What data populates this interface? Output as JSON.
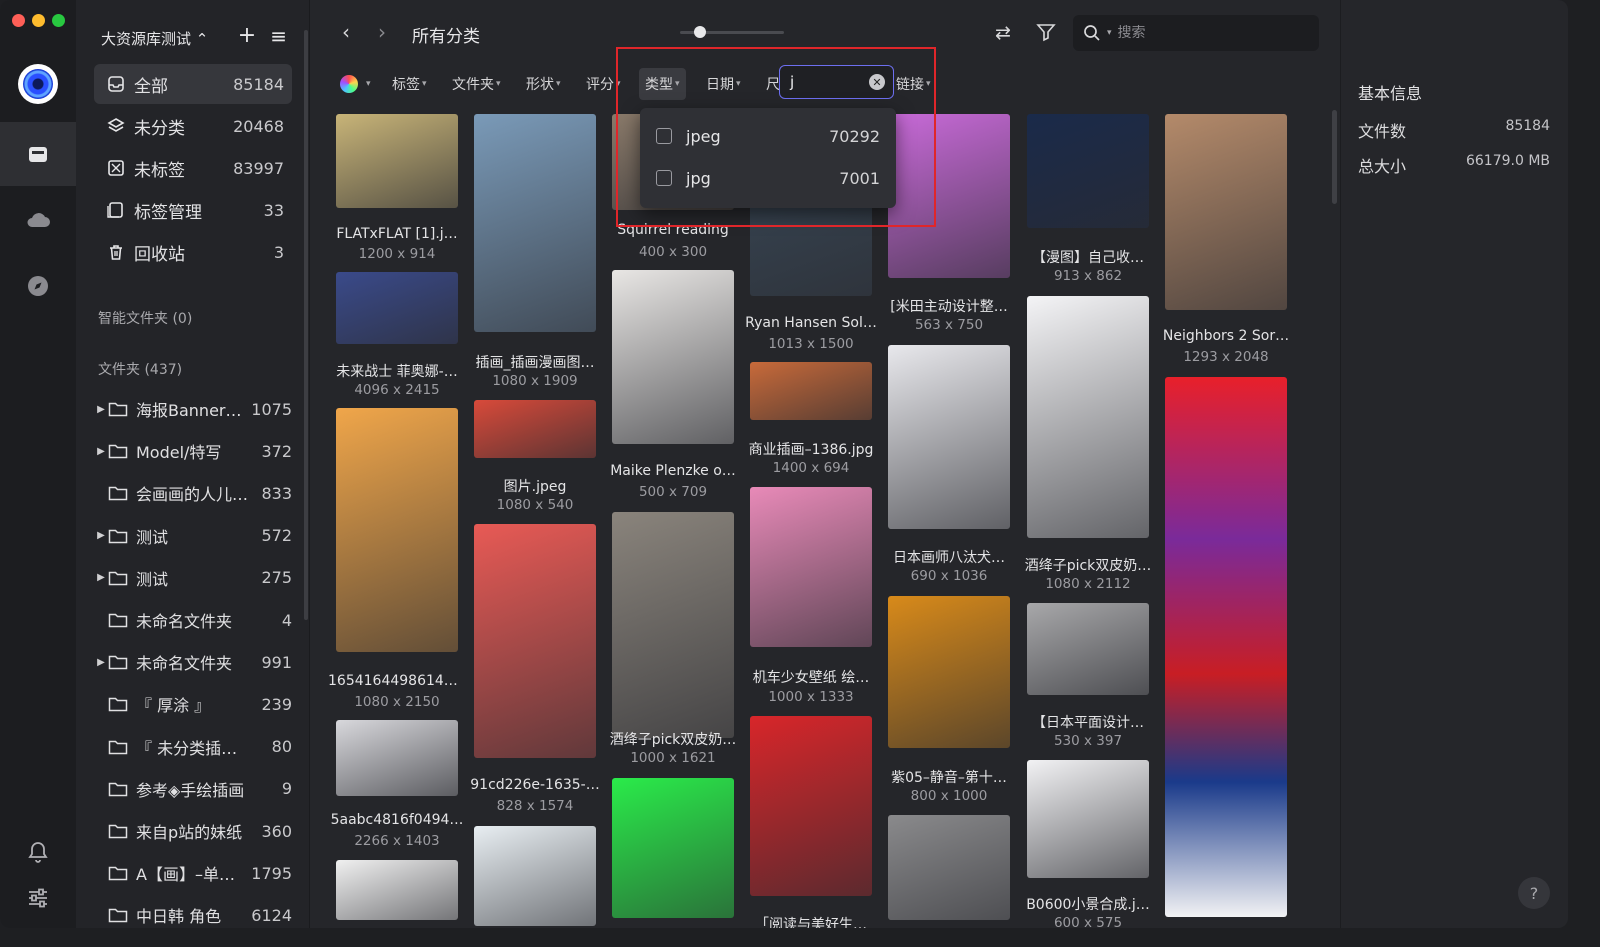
{
  "sidebar": {
    "library_title": "大资源库测试 ⌃",
    "nav": [
      {
        "label": "全部",
        "count": "85184"
      },
      {
        "label": "未分类",
        "count": "20468"
      },
      {
        "label": "未标签",
        "count": "83997"
      },
      {
        "label": "标签管理",
        "count": "33"
      },
      {
        "label": "回收站",
        "count": "3"
      }
    ],
    "smart_folders_label": "智能文件夹 (0)",
    "folders_label": "文件夹 (437)",
    "folders": [
      {
        "name": "海报Banner…",
        "count": "1075",
        "expandable": true
      },
      {
        "name": "Model/特写",
        "count": "372",
        "expandable": true
      },
      {
        "name": "会画画的人儿…",
        "count": "833",
        "expandable": false
      },
      {
        "name": "测试",
        "count": "572",
        "expandable": true
      },
      {
        "name": "测试",
        "count": "275",
        "expandable": true
      },
      {
        "name": "未命名文件夹",
        "count": "4",
        "expandable": false
      },
      {
        "name": "未命名文件夹",
        "count": "991",
        "expandable": true
      },
      {
        "name": "『 厚涂 』",
        "count": "239",
        "expandable": false
      },
      {
        "name": "『 未分类插画 』",
        "count": "80",
        "expandable": false
      },
      {
        "name": "参考◈手绘插画",
        "count": "9",
        "expandable": false
      },
      {
        "name": "来自p站的妹纸",
        "count": "360",
        "expandable": false
      },
      {
        "name": "A【画】–单…",
        "count": "1795",
        "expandable": false
      },
      {
        "name": "中日韩 角色",
        "count": "6124",
        "expandable": false
      }
    ]
  },
  "topbar": {
    "breadcrumb": "所有分类",
    "search_placeholder": "搜索"
  },
  "filters": {
    "items": [
      "标签",
      "文件夹",
      "形状",
      "评分",
      "类型",
      "日期",
      "尺",
      "链接"
    ],
    "type_query": "j",
    "type_options": [
      {
        "label": "jpeg",
        "count": "70292"
      },
      {
        "label": "jpg",
        "count": "7001"
      }
    ]
  },
  "grid": {
    "items": [
      {
        "name": "FLATxFLAT [1].j…",
        "size": "1200 x 914",
        "color": "#c8b478"
      },
      {
        "name": "未来战士 菲奥娜-…",
        "size": "4096 x 2415",
        "color": "#3a4a8a"
      },
      {
        "name": "16541644986143…",
        "size": "1080 x 2150",
        "color": "#f0a64a"
      },
      {
        "name": "5aabc4816f0494…",
        "size": "2266 x 1403",
        "color": "#d8d8dc"
      },
      {
        "name": "插画_插画漫画图…",
        "size": "1080 x 1909",
        "color": "#7a9ab8"
      },
      {
        "name": "图片.jpeg",
        "size": "1080 x 540",
        "color": "#d84a3a"
      },
      {
        "name": "91cd226e-1635-…",
        "size": "828 x 1574",
        "color": "#e85a55"
      },
      {
        "name": "Squirrel reading",
        "size": "400 x 300",
        "color": "#8a7a6a"
      },
      {
        "name": "Maike Plenzke o…",
        "size": "500 x 709",
        "color": "#e8e6e4"
      },
      {
        "name": "酒绛子pick双皮奶…",
        "size": "1000 x 1621",
        "color": "#8a847c"
      },
      {
        "name": "Ryan Hansen Sol…",
        "size": "1013 x 1500",
        "color": "#3a4a5a"
      },
      {
        "name": "商业插画–1386.jpg",
        "size": "1400 x 694",
        "color": "#c86a3a"
      },
      {
        "name": "机车少女壁纸 绘…",
        "size": "1000 x 1333",
        "color": "#e88ab8"
      },
      {
        "name": "「阅读与美好生…",
        "size": "",
        "color": "#d8262a"
      },
      {
        "name": "[米田主动设计整…",
        "size": "563 x 750",
        "color": "#c86ad8"
      },
      {
        "name": "日本画师八汰犬…",
        "size": "690 x 1036",
        "color": "#e8e8ec"
      },
      {
        "name": "紫05–静音–第十…",
        "size": "800 x 1000",
        "color": "#d88a1a"
      },
      {
        "name": "【漫图】自己收…",
        "size": "913 x 862",
        "color": "#1a2a4a"
      },
      {
        "name": "酒绛子pick双皮奶…",
        "size": "1080 x 2112",
        "color": "#f4f4f6"
      },
      {
        "name": "【日本平面设计…",
        "size": "530 x 397",
        "color": "#a8a8aa"
      },
      {
        "name": "B0600小景合成.j…",
        "size": "600 x 575",
        "color": "#f2f2f4"
      },
      {
        "name": "Neighbors 2 Sor…",
        "size": "1293 x 2048",
        "color": "#b48a6a"
      }
    ]
  },
  "info": {
    "title": "基本信息",
    "file_count_label": "文件数",
    "file_count": "85184",
    "total_size_label": "总大小",
    "total_size": "66179.0 MB"
  }
}
